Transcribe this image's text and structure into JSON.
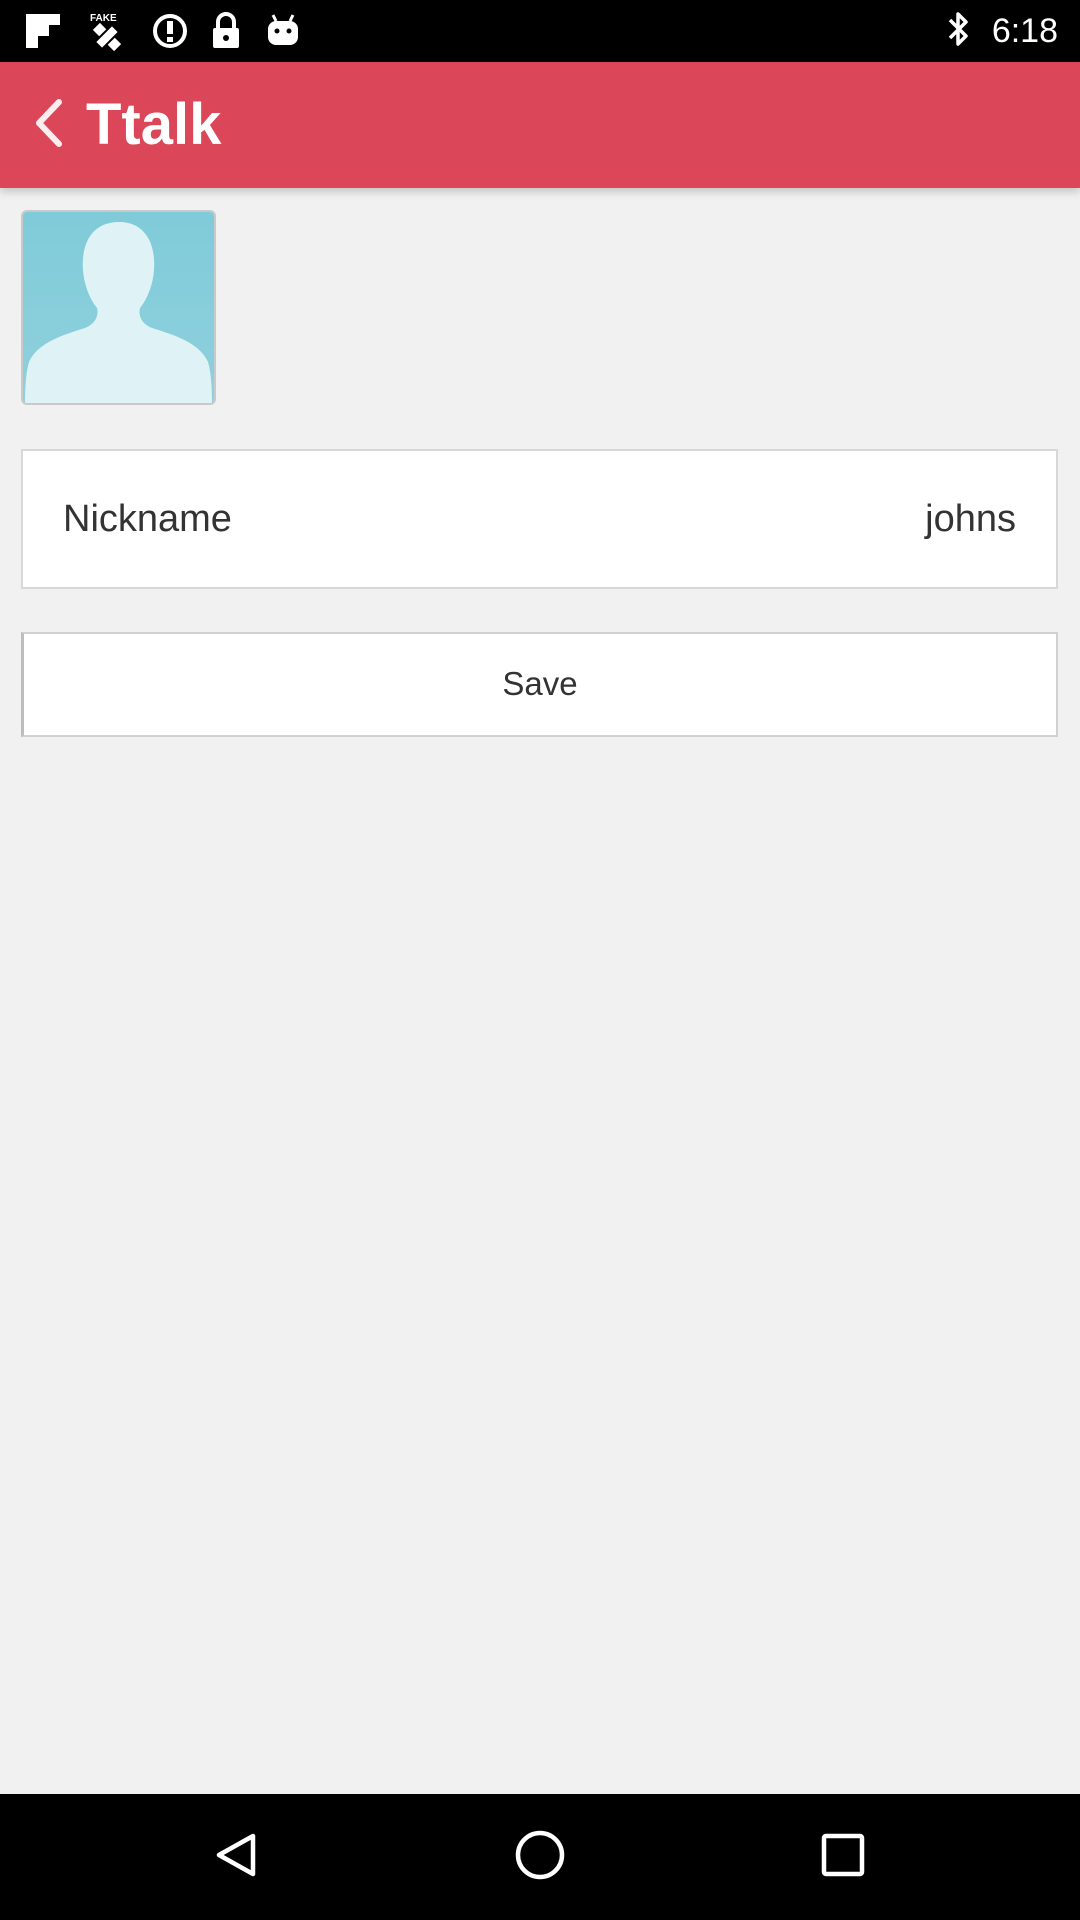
{
  "status_bar": {
    "time": "6:18",
    "left_icons": [
      "flipboard-icon",
      "fake-gps-icon",
      "alert-icon",
      "lock-icon",
      "android-icon"
    ],
    "right_icons": [
      "bluetooth-icon"
    ]
  },
  "app_bar": {
    "title": "Ttalk",
    "background_color": "#db4659"
  },
  "profile": {
    "avatar_icon": "person-silhouette-icon",
    "nickname_label": "Nickname",
    "nickname_value": "johns"
  },
  "actions": {
    "save_label": "Save"
  },
  "nav_bar": {
    "buttons": [
      "back-triangle-icon",
      "home-circle-icon",
      "recents-square-icon"
    ]
  }
}
